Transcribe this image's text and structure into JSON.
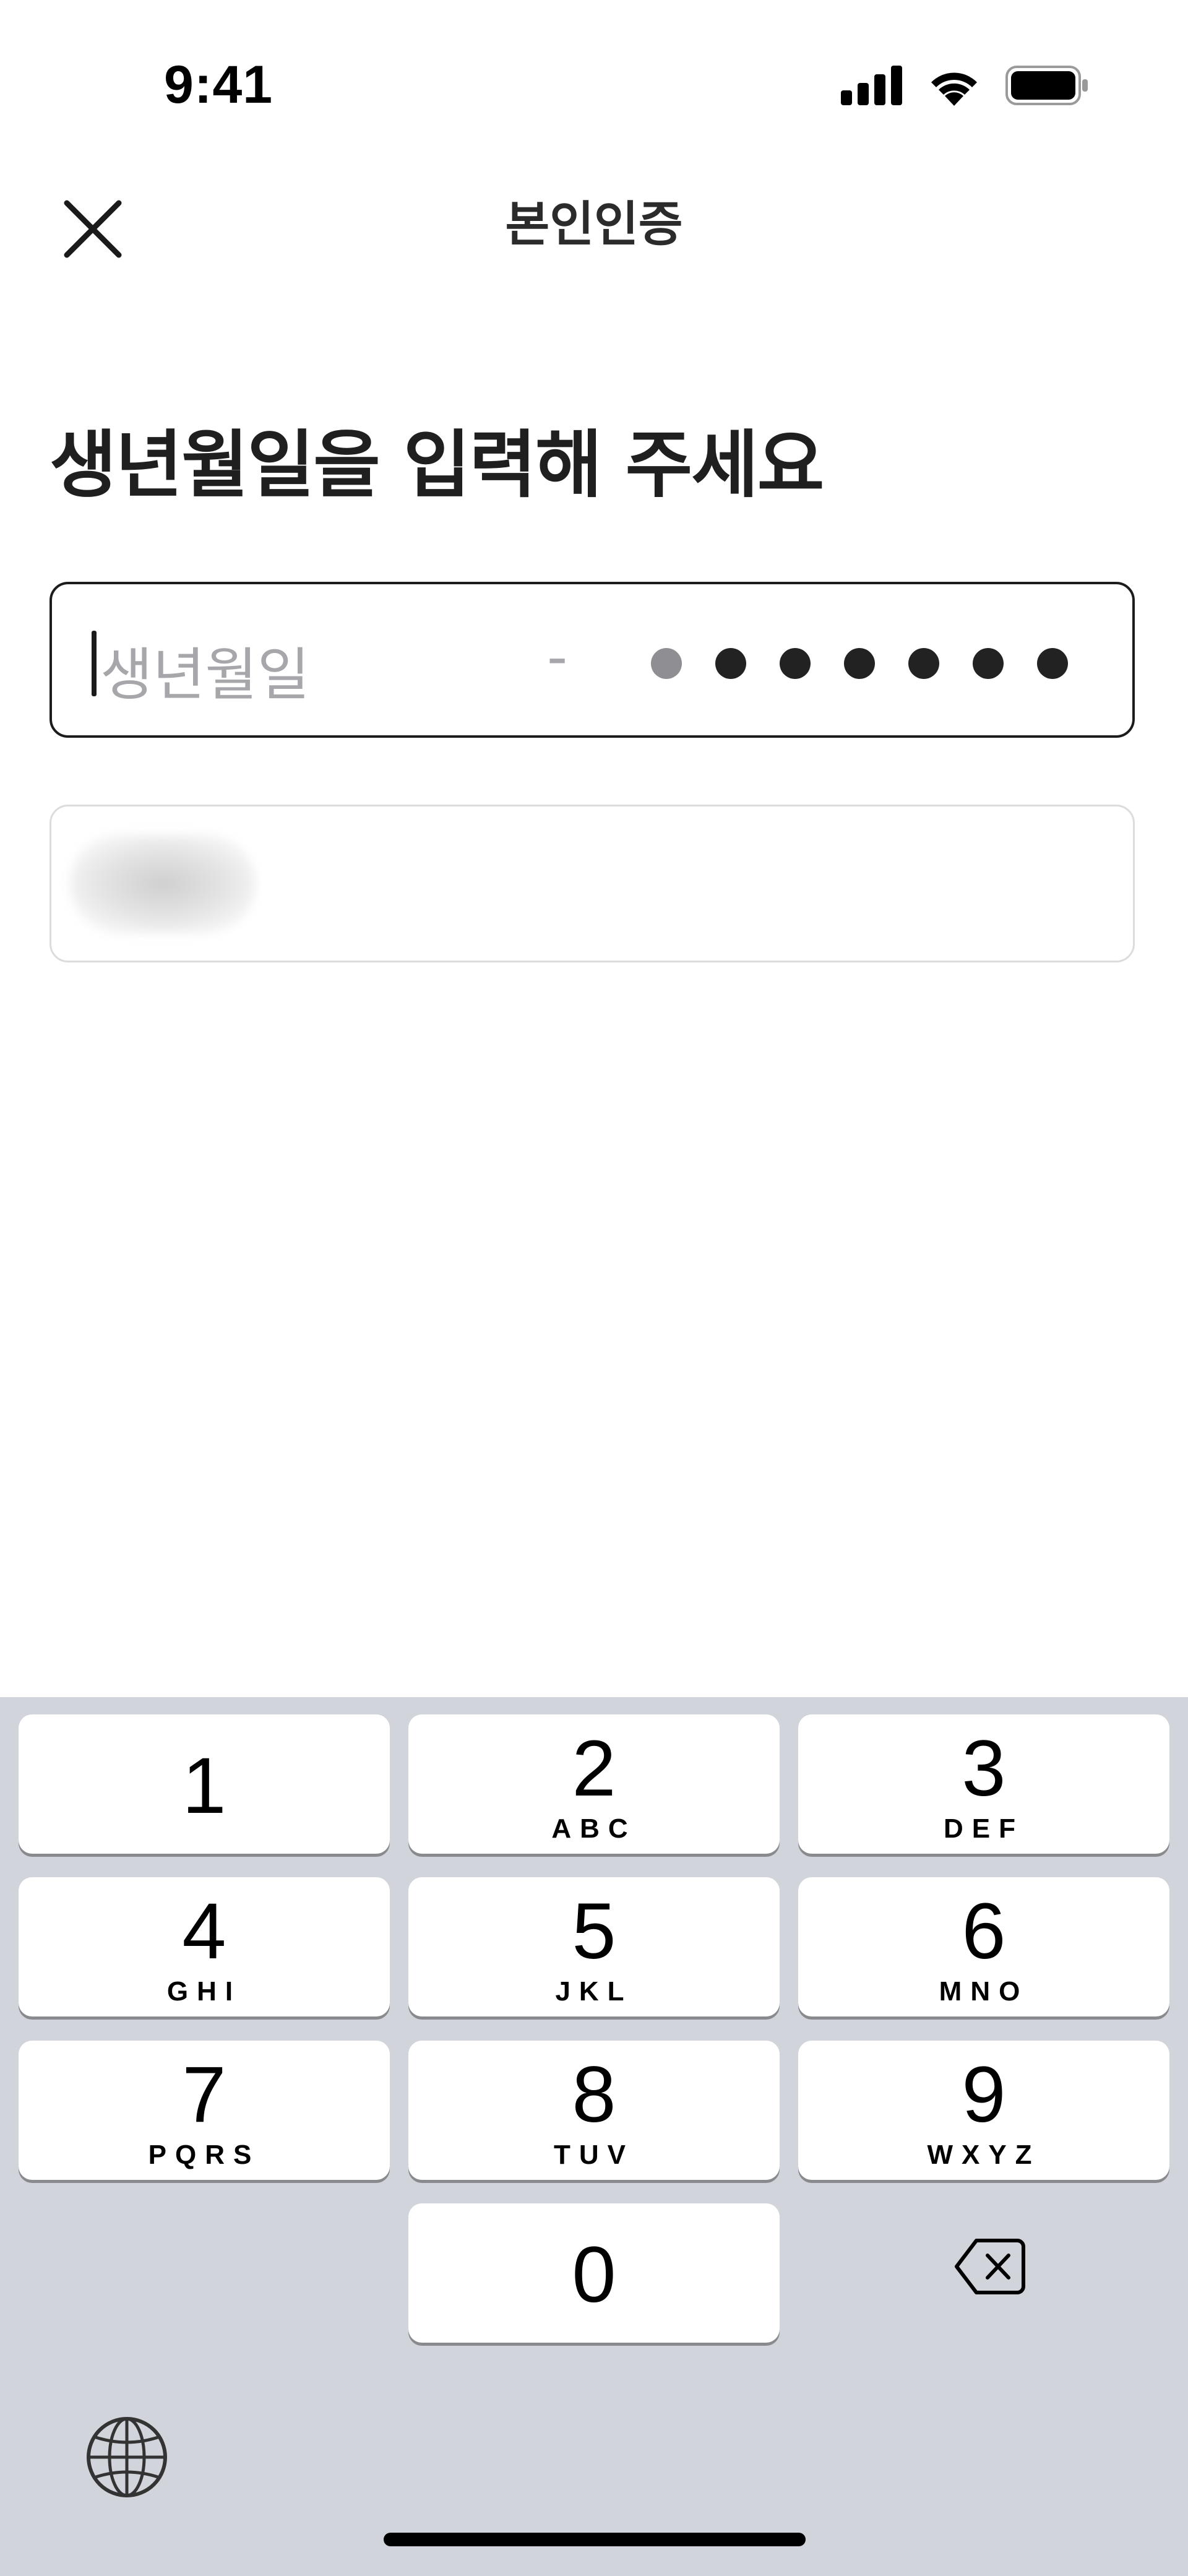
{
  "status_bar": {
    "time": "9:41"
  },
  "nav": {
    "title": "본인인증"
  },
  "heading": "생년월일을 입력해 주세요",
  "birth_input": {
    "placeholder": "생년월일",
    "separator": "-",
    "masked_digits": 7
  },
  "keyboard": {
    "keys": [
      {
        "num": "1",
        "letters": ""
      },
      {
        "num": "2",
        "letters": "ABC"
      },
      {
        "num": "3",
        "letters": "DEF"
      },
      {
        "num": "4",
        "letters": "GHI"
      },
      {
        "num": "5",
        "letters": "JKL"
      },
      {
        "num": "6",
        "letters": "MNO"
      },
      {
        "num": "7",
        "letters": "PQRS"
      },
      {
        "num": "8",
        "letters": "TUV"
      },
      {
        "num": "9",
        "letters": "WXYZ"
      },
      {
        "num": "0",
        "letters": ""
      }
    ]
  },
  "colors": {
    "keyboard_bg": "#d1d4db",
    "key_bg": "#ffffff",
    "input_border": "#1c1c1c",
    "placeholder": "#a6a6ab"
  },
  "icons": [
    "signal-icon",
    "wifi-icon",
    "battery-icon",
    "close-icon",
    "backspace-icon",
    "globe-icon"
  ]
}
